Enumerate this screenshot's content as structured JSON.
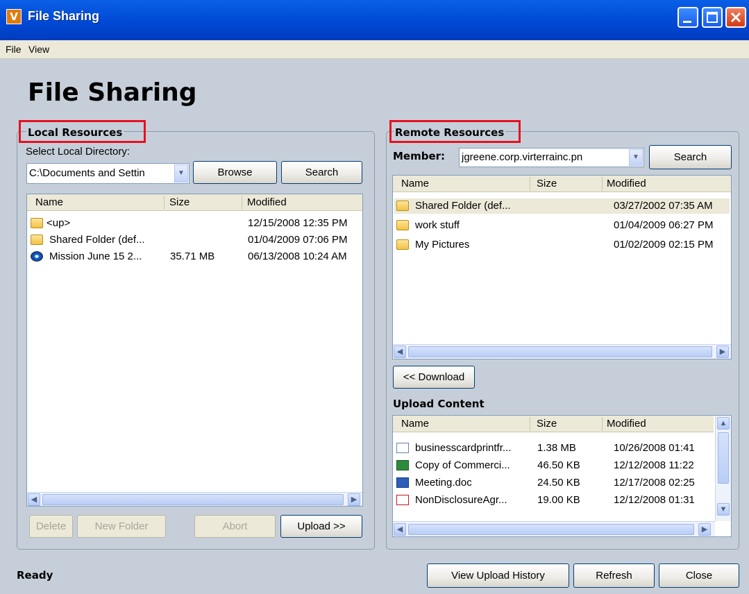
{
  "window": {
    "title": "File Sharing",
    "app_icon_letter": "V"
  },
  "menu": {
    "file": "File",
    "view": "View"
  },
  "page_title": "File Sharing",
  "local": {
    "group_label": "Local Resources",
    "dir_label": "Select Local Directory:",
    "dir_value": "C:\\Documents and Settin",
    "browse": "Browse",
    "search": "Search",
    "columns": [
      "Name",
      "Size",
      "Modified"
    ],
    "rows": [
      {
        "name": "<up>",
        "size": "",
        "modified": "12/15/2008 12:35 PM",
        "icon": "folder-up-icon"
      },
      {
        "name": "Shared Folder (def...",
        "size": "",
        "modified": "01/04/2009 07:06 PM",
        "icon": "folder-icon"
      },
      {
        "name": "Mission June 15 2...",
        "size": "35.71 MB",
        "modified": "06/13/2008 10:24 AM",
        "icon": "media-file-icon"
      }
    ],
    "buttons": {
      "delete": "Delete",
      "new_folder": "New Folder",
      "abort": "Abort",
      "upload": "Upload >>"
    }
  },
  "remote": {
    "group_label": "Remote Resources",
    "member_label": "Member:",
    "member_value": "jgreene.corp.virterrainc.pn",
    "search": "Search",
    "columns": [
      "Name",
      "Size",
      "Modified"
    ],
    "rows": [
      {
        "name": "Shared Folder (def...",
        "size": "",
        "modified": "03/27/2002 07:35 AM",
        "icon": "folder-icon"
      },
      {
        "name": "work stuff",
        "size": "",
        "modified": "01/04/2009 06:27 PM",
        "icon": "folder-icon"
      },
      {
        "name": "My Pictures",
        "size": "",
        "modified": "01/02/2009 02:15 PM",
        "icon": "folder-icon"
      }
    ],
    "download": "<< Download",
    "upload_content_label": "Upload Content",
    "upload_columns": [
      "Name",
      "Size",
      "Modified"
    ],
    "upload_rows": [
      {
        "name": "businesscardprintfr...",
        "size": "1.38 MB",
        "modified": "10/26/2008 01:41",
        "icon": "image-file-icon"
      },
      {
        "name": "Copy of Commerci...",
        "size": "46.50 KB",
        "modified": "12/12/2008 11:22",
        "icon": "excel-file-icon"
      },
      {
        "name": "Meeting.doc",
        "size": "24.50 KB",
        "modified": "12/17/2008 02:25",
        "icon": "word-file-icon"
      },
      {
        "name": "NonDisclosureAgr...",
        "size": "19.00 KB",
        "modified": "12/12/2008 01:31",
        "icon": "pdf-file-icon"
      }
    ]
  },
  "footer": {
    "status": "Ready",
    "view_history": "View Upload History",
    "refresh": "Refresh",
    "close": "Close"
  },
  "colors": {
    "titlebar": "#0049d4",
    "background": "#c6cfd9",
    "highlight_box": "#e81020",
    "selection": "#ece9d8"
  }
}
